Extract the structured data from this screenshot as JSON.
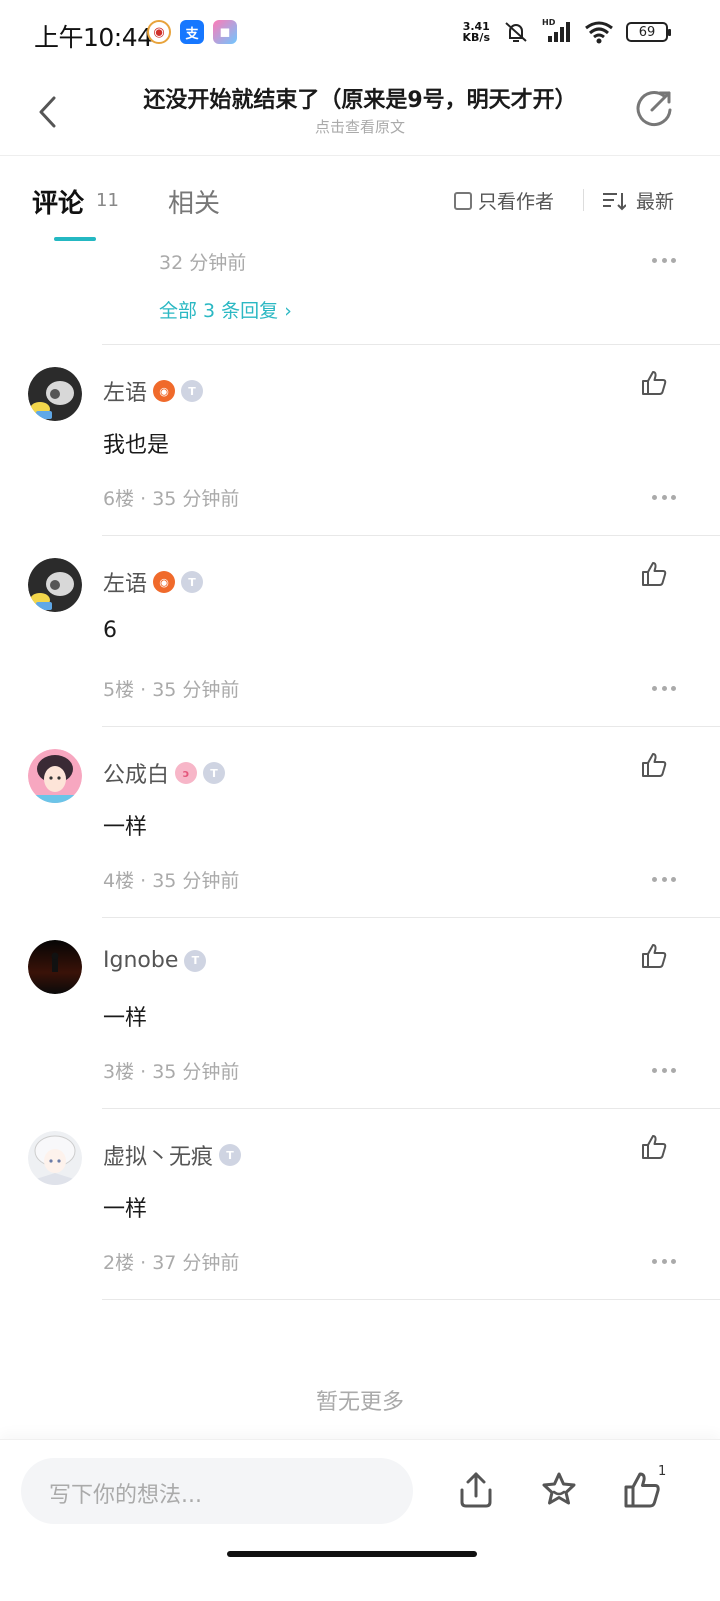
{
  "status_bar": {
    "time": "上午10:44",
    "net_speed_value": "3.41",
    "net_speed_unit": "KB/s",
    "signal_label": "HD",
    "battery": "69"
  },
  "header": {
    "title": "还没开始就结束了（原来是9号，明天才开）",
    "subtitle": "点击查看原文"
  },
  "tabs": {
    "comments_label": "评论",
    "comments_count": "11",
    "related_label": "相关",
    "only_author_label": "只看作者",
    "sort_label": "最新"
  },
  "partial_reply": {
    "time": "32 分钟前",
    "all_replies": "全部 3 条回复 ›"
  },
  "comments": [
    {
      "user": "左语",
      "content": "我也是",
      "floor": "6楼",
      "time": "35 分钟前"
    },
    {
      "user": "左语",
      "content": "6",
      "floor": "5楼",
      "time": "35 分钟前"
    },
    {
      "user": "公成白",
      "content": "一样",
      "floor": "4楼",
      "time": "35 分钟前"
    },
    {
      "user": "Ignobe",
      "content": "一样",
      "floor": "3楼",
      "time": "35 分钟前"
    },
    {
      "user": "虚拟丶无痕",
      "content": "一样",
      "floor": "2楼",
      "time": "37 分钟前"
    }
  ],
  "no_more": "暂无更多",
  "bottom_bar": {
    "input_placeholder": "写下你的想法...",
    "like_count": "1"
  },
  "colors": {
    "accent": "#24b8c2",
    "link": "#2bb8c3"
  }
}
